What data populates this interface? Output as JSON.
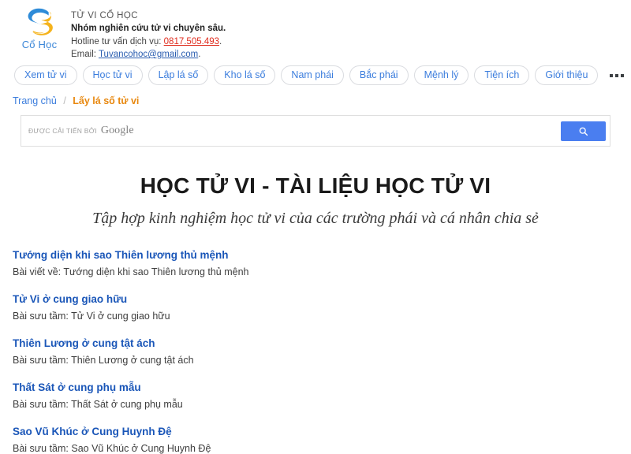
{
  "header": {
    "logo_word": "Cổ Học",
    "brand_name": "TỬ VI CỔ HỌC",
    "tagline": "Nhóm nghiên cứu tử vi chuyên sâu.",
    "hotline_label": "Hotline tư vấn dịch vụ:",
    "hotline_number": "0817.505.493",
    "hotline_suffix": ".",
    "email_label": "Email:",
    "email_address": "Tuvancohoc@gmail.com",
    "email_suffix": "."
  },
  "nav": {
    "items": [
      {
        "label": "Xem tử vi"
      },
      {
        "label": "Học tử vi"
      },
      {
        "label": "Lập lá số"
      },
      {
        "label": "Kho lá số"
      },
      {
        "label": "Nam phái"
      },
      {
        "label": "Bắc phái"
      },
      {
        "label": "Mệnh lý"
      },
      {
        "label": "Tiện ích"
      },
      {
        "label": "Giới thiệu"
      }
    ],
    "more_icon": "ellipsis-icon"
  },
  "breadcrumb": {
    "home": "Trang chủ",
    "separator": "/",
    "current": "Lấy lá số tử vi"
  },
  "search": {
    "cse_label": "ĐƯỢC CẢI TIẾN BỞI",
    "cse_brand": "Google",
    "input_value": "",
    "placeholder": "",
    "button_icon": "search-icon"
  },
  "main": {
    "title": "HỌC TỬ VI - TÀI LIỆU HỌC TỬ VI",
    "subtitle": "Tập hợp kinh nghiệm học tử vi của các trường phái và cá nhân chia sẻ",
    "articles": [
      {
        "title": "Tướng diện khi sao Thiên lương thủ mệnh",
        "desc": "Bài viết về: Tướng diện khi sao Thiên lương thủ mệnh"
      },
      {
        "title": "Tử Vi ở cung giao hữu",
        "desc": "Bài sưu tầm: Tử Vi ở cung giao hữu"
      },
      {
        "title": "Thiên Lương ở cung tật ách",
        "desc": "Bài sưu tầm: Thiên Lương ở cung tật ách"
      },
      {
        "title": "Thất Sát ở cung phụ mẫu",
        "desc": "Bài sưu tầm: Thất Sát ở cung phụ mẫu"
      },
      {
        "title": "Sao Vũ Khúc ở Cung Huynh Đệ",
        "desc": "Bài sưu tầm: Sao Vũ Khúc ở Cung Huynh Đệ"
      }
    ]
  },
  "colors": {
    "link_blue": "#1a56b8",
    "nav_blue": "#3b7ddd",
    "accent_orange": "#e8880f",
    "phone_red": "#e02b1d",
    "button_blue": "#4a7ef0",
    "logo_blue": "#2e8bd8",
    "logo_yellow": "#f5b31c"
  }
}
